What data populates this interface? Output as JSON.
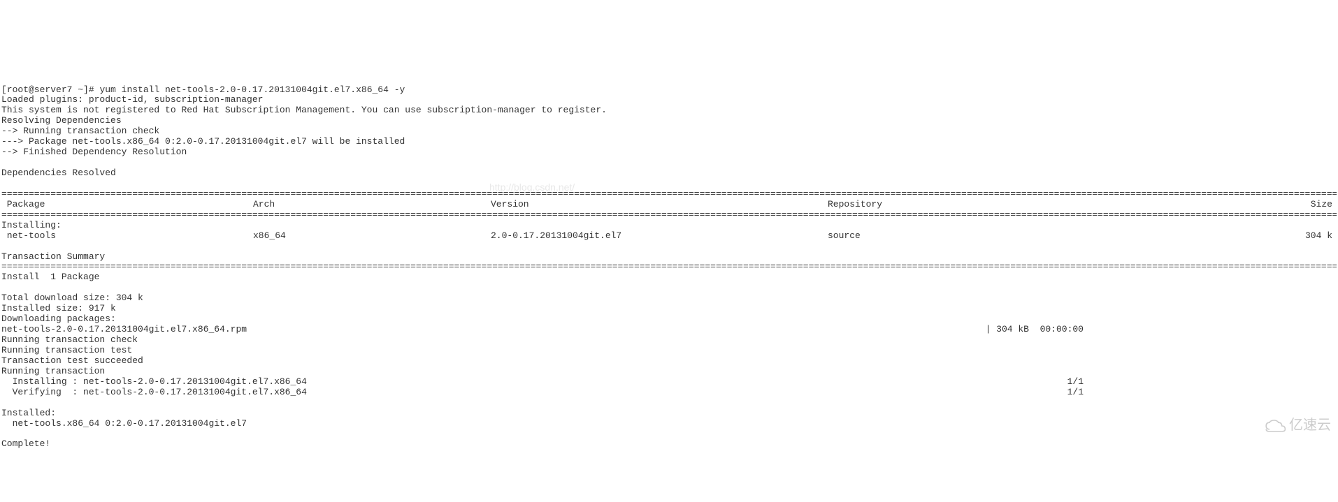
{
  "prompt": "[root@server7 ~]# ",
  "command": "yum install net-tools-2.0-0.17.20131004git.el7.x86_64 -y",
  "lines": {
    "loaded_plugins": "Loaded plugins: product-id, subscription-manager",
    "not_registered": "This system is not registered to Red Hat Subscription Management. You can use subscription-manager to register.",
    "resolving": "Resolving Dependencies",
    "trans_check": "--> Running transaction check",
    "pkg_will_install": "---> Package net-tools.x86_64 0:2.0-0.17.20131004git.el7 will be installed",
    "finished_dep": "--> Finished Dependency Resolution",
    "deps_resolved": "Dependencies Resolved"
  },
  "headers": {
    "package": " Package",
    "arch": "Arch",
    "version": "Version",
    "repository": "Repository",
    "size": "Size"
  },
  "installing_label": "Installing:",
  "pkg_row": {
    "name": " net-tools",
    "arch": "x86_64",
    "version": "2.0-0.17.20131004git.el7",
    "repo": "source",
    "size": "304 k"
  },
  "summary": {
    "title": "Transaction Summary",
    "install": "Install  1 Package",
    "total_dl": "Total download size: 304 k",
    "installed_size": "Installed size: 917 k",
    "downloading": "Downloading packages:",
    "rpm_left": "net-tools-2.0-0.17.20131004git.el7.x86_64.rpm",
    "rpm_right": "| 304 kB  00:00:00",
    "run_check": "Running transaction check",
    "run_test": "Running transaction test",
    "test_ok": "Transaction test succeeded",
    "run_trans": "Running transaction",
    "installing_left": "  Installing : net-tools-2.0-0.17.20131004git.el7.x86_64",
    "installing_right": "1/1",
    "verifying_left": "  Verifying  : net-tools-2.0-0.17.20131004git.el7.x86_64",
    "verifying_right": "1/1",
    "installed_label": "Installed:",
    "installed_pkg": "  net-tools.x86_64 0:2.0-0.17.20131004git.el7",
    "complete": "Complete!"
  },
  "watermark_text": "http://blog.csdn.net/",
  "watermark_logo": "亿速云",
  "rule_char": "="
}
